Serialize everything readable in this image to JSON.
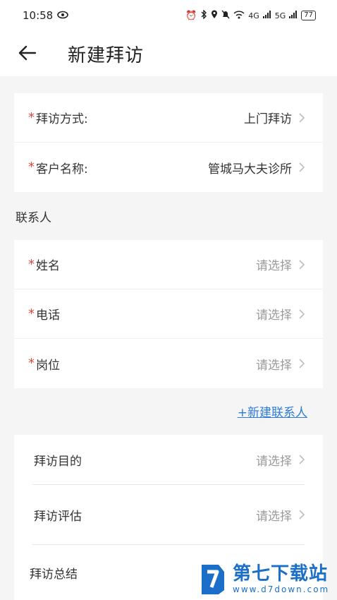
{
  "status_bar": {
    "time": "10:58",
    "network_1": "4G",
    "network_2": "5G",
    "battery": "77"
  },
  "header": {
    "title": "新建拜访"
  },
  "visit_card": {
    "method": {
      "label": "拜访方式:",
      "value": "上门拜访"
    },
    "customer": {
      "label": "客户名称:",
      "value": "管城马大夫诊所"
    }
  },
  "contact_section": {
    "title": "联系人",
    "name": {
      "label": "姓名",
      "placeholder": "请选择"
    },
    "phone": {
      "label": "电话",
      "placeholder": "请选择"
    },
    "position": {
      "label": "岗位",
      "placeholder": "请选择"
    },
    "add_contact": "+新建联系人"
  },
  "details_card": {
    "purpose": {
      "label": "拜访目的",
      "placeholder": "请选择"
    },
    "assessment": {
      "label": "拜访评估",
      "placeholder": "请选择"
    },
    "summary": {
      "label": "拜访总结"
    }
  },
  "watermark": {
    "name": "第七下载站",
    "url": "www.d7down.com"
  },
  "colors": {
    "required_star": "#e2463f",
    "link": "#2e7bd8",
    "placeholder": "#9a9a9a",
    "background": "#f5f5f5"
  }
}
